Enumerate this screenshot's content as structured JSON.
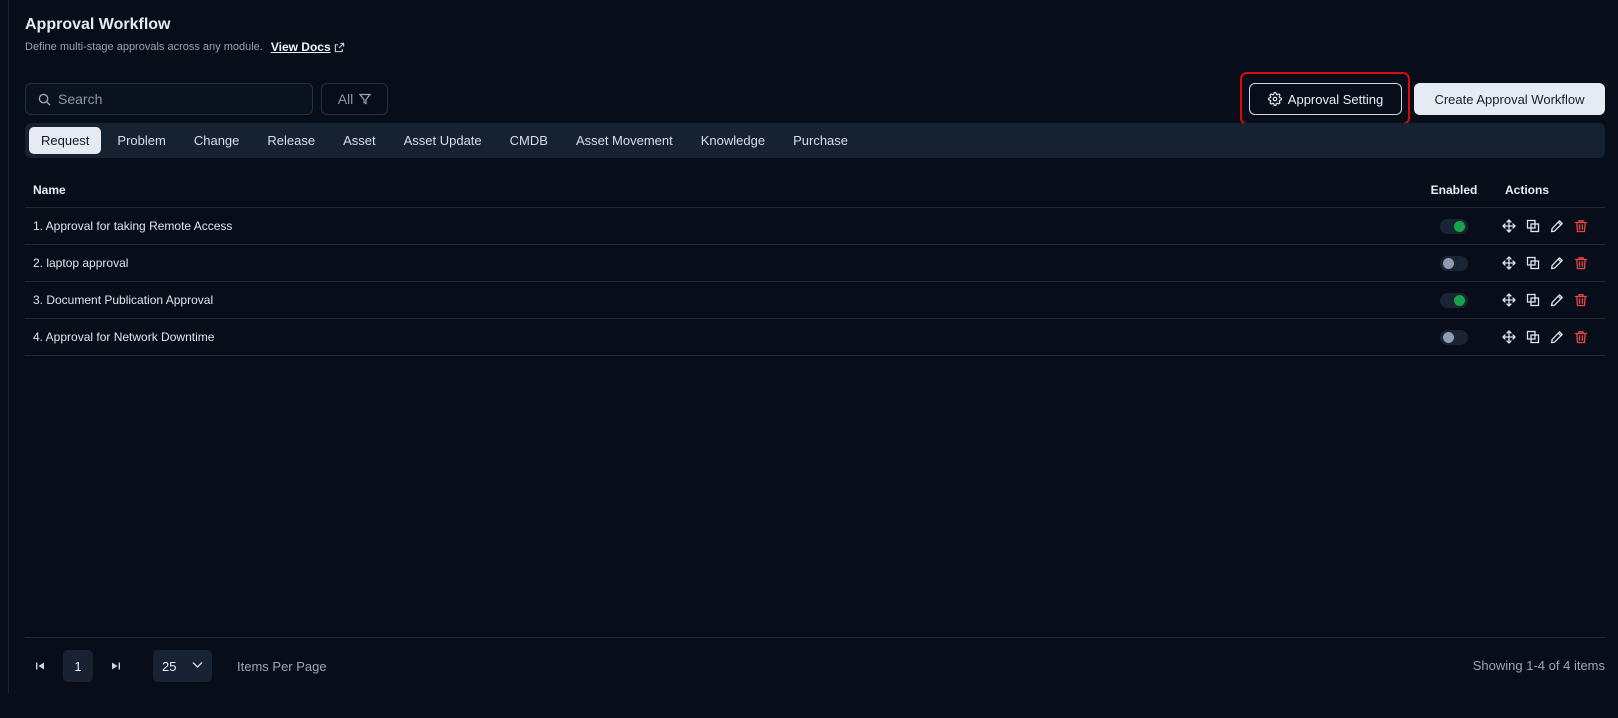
{
  "header": {
    "title": "Approval Workflow",
    "subtitle": "Define multi-stage approvals across any module.",
    "docs_label": "View Docs"
  },
  "toolbar": {
    "search_placeholder": "Search",
    "filter_label": "All",
    "setting_label": "Approval Setting",
    "create_label": "Create Approval Workflow"
  },
  "tabs": [
    {
      "label": "Request",
      "active": true
    },
    {
      "label": "Problem"
    },
    {
      "label": "Change"
    },
    {
      "label": "Release"
    },
    {
      "label": "Asset"
    },
    {
      "label": "Asset Update"
    },
    {
      "label": "CMDB"
    },
    {
      "label": "Asset Movement"
    },
    {
      "label": "Knowledge"
    },
    {
      "label": "Purchase"
    }
  ],
  "table": {
    "columns": {
      "name": "Name",
      "enabled": "Enabled",
      "actions": "Actions"
    },
    "rows": [
      {
        "name": "1. Approval for taking Remote Access",
        "enabled": true
      },
      {
        "name": "2. laptop approval",
        "enabled": false
      },
      {
        "name": "3. Document Publication Approval",
        "enabled": true
      },
      {
        "name": "4. Approval for Network Downtime",
        "enabled": false
      }
    ],
    "action_icons": [
      "move-icon",
      "copy-icon",
      "edit-icon",
      "delete-icon"
    ]
  },
  "pagination": {
    "current_page": "1",
    "page_size": "25",
    "page_size_label": "Items Per Page",
    "showing": "Showing 1-4 of 4 items"
  },
  "colors": {
    "background": "#070e1a",
    "toggle_on": "#16a34a",
    "toggle_off": "#8f9bb0",
    "delete": "#ef4444",
    "highlight": "#d90b0b"
  }
}
